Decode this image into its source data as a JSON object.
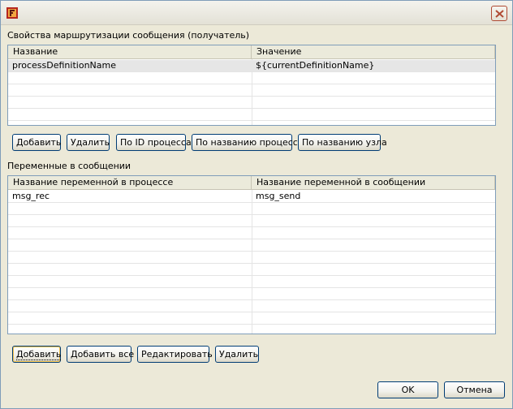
{
  "window": {
    "close_icon": "close-icon",
    "app_icon": "app-icon"
  },
  "routing": {
    "label": "Свойства маршрутизации сообщения (получатель)",
    "columns": [
      "Название",
      "Значение"
    ],
    "rows": [
      [
        "processDefinitionName",
        "${currentDefinitionName}"
      ]
    ],
    "buttons": {
      "add": "Добавить",
      "remove": "Удалить",
      "by_process_id": "По ID процесса",
      "by_process_name": "По названию процесса",
      "by_node_name": "По названию узла"
    }
  },
  "variables": {
    "label": "Переменные в сообщении",
    "columns": [
      "Название переменной в процессе",
      "Название переменной в сообщении"
    ],
    "rows": [
      [
        "msg_rec",
        "msg_send"
      ]
    ],
    "buttons": {
      "add": "Добавить",
      "add_all": "Добавить все",
      "edit": "Редактировать",
      "remove": "Удалить"
    }
  },
  "footer": {
    "ok": "OK",
    "cancel": "Отмена"
  }
}
